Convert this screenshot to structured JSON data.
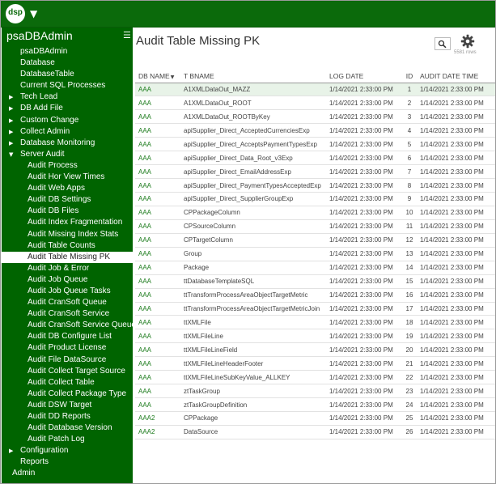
{
  "app": {
    "logo_text": "dsp",
    "title": "psaDBAdmin"
  },
  "nav": [
    {
      "label": "psaDBAdmin",
      "level": 0,
      "arrow": ""
    },
    {
      "label": "Database",
      "level": 0,
      "arrow": ""
    },
    {
      "label": "DatabaseTable",
      "level": 0,
      "arrow": ""
    },
    {
      "label": "Current SQL Processes",
      "level": 0,
      "arrow": ""
    },
    {
      "label": "Tech Lead",
      "level": 0,
      "arrow": "▶"
    },
    {
      "label": "DB Add File",
      "level": 0,
      "arrow": "▶"
    },
    {
      "label": "Custom Change",
      "level": 0,
      "arrow": "▶"
    },
    {
      "label": "Collect Admin",
      "level": 0,
      "arrow": "▶"
    },
    {
      "label": "Database Monitoring",
      "level": 0,
      "arrow": "▶"
    },
    {
      "label": "Server Audit",
      "level": 0,
      "arrow": "▼"
    },
    {
      "label": "Audit Process",
      "level": 1,
      "arrow": ""
    },
    {
      "label": "Audit Hor View Times",
      "level": 1,
      "arrow": ""
    },
    {
      "label": "Audit Web Apps",
      "level": 1,
      "arrow": ""
    },
    {
      "label": "Audit DB Settings",
      "level": 1,
      "arrow": ""
    },
    {
      "label": "Audit DB Files",
      "level": 1,
      "arrow": ""
    },
    {
      "label": "Audit Index Fragmentation",
      "level": 1,
      "arrow": ""
    },
    {
      "label": "Audit Missing Index Stats",
      "level": 1,
      "arrow": ""
    },
    {
      "label": "Audit Table Counts",
      "level": 1,
      "arrow": ""
    },
    {
      "label": "Audit Table Missing PK",
      "level": 1,
      "arrow": "",
      "active": true
    },
    {
      "label": "Audit Job & Error",
      "level": 1,
      "arrow": ""
    },
    {
      "label": "Audit Job Queue",
      "level": 1,
      "arrow": ""
    },
    {
      "label": "Audit Job Queue Tasks",
      "level": 1,
      "arrow": ""
    },
    {
      "label": "Audit CranSoft Queue",
      "level": 1,
      "arrow": ""
    },
    {
      "label": "Audit CranSoft Service",
      "level": 1,
      "arrow": ""
    },
    {
      "label": "Audit CranSoft Service Queue",
      "level": 1,
      "arrow": ""
    },
    {
      "label": "Audit DB Configure List",
      "level": 1,
      "arrow": ""
    },
    {
      "label": "Audit Product License",
      "level": 1,
      "arrow": ""
    },
    {
      "label": "Audit File DataSource",
      "level": 1,
      "arrow": ""
    },
    {
      "label": "Audit Collect Target Source",
      "level": 1,
      "arrow": ""
    },
    {
      "label": "Audit Collect Table",
      "level": 1,
      "arrow": ""
    },
    {
      "label": "Audit Collect Package Type",
      "level": 1,
      "arrow": ""
    },
    {
      "label": "Audit DSW Target",
      "level": 1,
      "arrow": ""
    },
    {
      "label": "Audit DD Reports",
      "level": 1,
      "arrow": ""
    },
    {
      "label": "Audit Database Version",
      "level": 1,
      "arrow": ""
    },
    {
      "label": "Audit Patch Log",
      "level": 1,
      "arrow": ""
    },
    {
      "label": "Configuration",
      "level": 0,
      "arrow": "▶"
    },
    {
      "label": "Reports",
      "level": 0,
      "arrow": ""
    },
    {
      "label": "Admin",
      "level": -1,
      "arrow": ""
    }
  ],
  "main": {
    "title": "Audit Table Missing PK",
    "row_count": "5581 rows",
    "columns": [
      "DB NAME",
      "T BNAME",
      "LOG DATE",
      "ID",
      "AUDIT DATE TIME"
    ],
    "rows": [
      [
        "AAA",
        "A1XMLDataOut_MAZZ",
        "1/14/2021 2:33:00 PM",
        "1",
        "1/14/2021 2:33:00 PM"
      ],
      [
        "AAA",
        "A1XMLDataOut_ROOT",
        "1/14/2021 2:33:00 PM",
        "2",
        "1/14/2021 2:33:00 PM"
      ],
      [
        "AAA",
        "A1XMLDataOut_ROOTByKey",
        "1/14/2021 2:33:00 PM",
        "3",
        "1/14/2021 2:33:00 PM"
      ],
      [
        "AAA",
        "apiSupplier_Direct_AcceptedCurrenciesExp",
        "1/14/2021 2:33:00 PM",
        "4",
        "1/14/2021 2:33:00 PM"
      ],
      [
        "AAA",
        "apiSupplier_Direct_AcceptsPaymentTypesExp",
        "1/14/2021 2:33:00 PM",
        "5",
        "1/14/2021 2:33:00 PM"
      ],
      [
        "AAA",
        "apiSupplier_Direct_Data_Root_v3Exp",
        "1/14/2021 2:33:00 PM",
        "6",
        "1/14/2021 2:33:00 PM"
      ],
      [
        "AAA",
        "apiSupplier_Direct_EmailAddressExp",
        "1/14/2021 2:33:00 PM",
        "7",
        "1/14/2021 2:33:00 PM"
      ],
      [
        "AAA",
        "apiSupplier_Direct_PaymentTypesAcceptedExp",
        "1/14/2021 2:33:00 PM",
        "8",
        "1/14/2021 2:33:00 PM"
      ],
      [
        "AAA",
        "apiSupplier_Direct_SupplierGroupExp",
        "1/14/2021 2:33:00 PM",
        "9",
        "1/14/2021 2:33:00 PM"
      ],
      [
        "AAA",
        "CPPackageColumn",
        "1/14/2021 2:33:00 PM",
        "10",
        "1/14/2021 2:33:00 PM"
      ],
      [
        "AAA",
        "CPSourceColumn",
        "1/14/2021 2:33:00 PM",
        "11",
        "1/14/2021 2:33:00 PM"
      ],
      [
        "AAA",
        "CPTargetColumn",
        "1/14/2021 2:33:00 PM",
        "12",
        "1/14/2021 2:33:00 PM"
      ],
      [
        "AAA",
        "Group",
        "1/14/2021 2:33:00 PM",
        "13",
        "1/14/2021 2:33:00 PM"
      ],
      [
        "AAA",
        "Package",
        "1/14/2021 2:33:00 PM",
        "14",
        "1/14/2021 2:33:00 PM"
      ],
      [
        "AAA",
        "ttDatabaseTemplateSQL",
        "1/14/2021 2:33:00 PM",
        "15",
        "1/14/2021 2:33:00 PM"
      ],
      [
        "AAA",
        "ttTransformProcessAreaObjectTargetMetric",
        "1/14/2021 2:33:00 PM",
        "16",
        "1/14/2021 2:33:00 PM"
      ],
      [
        "AAA",
        "ttTransformProcessAreaObjectTargetMetricJoin",
        "1/14/2021 2:33:00 PM",
        "17",
        "1/14/2021 2:33:00 PM"
      ],
      [
        "AAA",
        "ttXMLFile",
        "1/14/2021 2:33:00 PM",
        "18",
        "1/14/2021 2:33:00 PM"
      ],
      [
        "AAA",
        "ttXMLFileLine",
        "1/14/2021 2:33:00 PM",
        "19",
        "1/14/2021 2:33:00 PM"
      ],
      [
        "AAA",
        "ttXMLFileLineField",
        "1/14/2021 2:33:00 PM",
        "20",
        "1/14/2021 2:33:00 PM"
      ],
      [
        "AAA",
        "ttXMLFileLineHeaderFooter",
        "1/14/2021 2:33:00 PM",
        "21",
        "1/14/2021 2:33:00 PM"
      ],
      [
        "AAA",
        "ttXMLFileLineSubKeyValue_ALLKEY",
        "1/14/2021 2:33:00 PM",
        "22",
        "1/14/2021 2:33:00 PM"
      ],
      [
        "AAA",
        "ztTaskGroup",
        "1/14/2021 2:33:00 PM",
        "23",
        "1/14/2021 2:33:00 PM"
      ],
      [
        "AAA",
        "ztTaskGroupDefinition",
        "1/14/2021 2:33:00 PM",
        "24",
        "1/14/2021 2:33:00 PM"
      ],
      [
        "AAA2",
        "CPPackage",
        "1/14/2021 2:33:00 PM",
        "25",
        "1/14/2021 2:33:00 PM"
      ],
      [
        "AAA2",
        "DataSource",
        "1/14/2021 2:33:00 PM",
        "26",
        "1/14/2021 2:33:00 PM"
      ]
    ]
  },
  "icons": {
    "search": "search-icon",
    "settings": "gear-icon",
    "sort": "sort-down-icon",
    "menu": "hamburger-icon"
  },
  "colors": {
    "brand_green": "#006400",
    "header_green": "#0b6a0b",
    "db_name_green": "#1a7a1a",
    "selected_row": "#e8f3e8"
  }
}
